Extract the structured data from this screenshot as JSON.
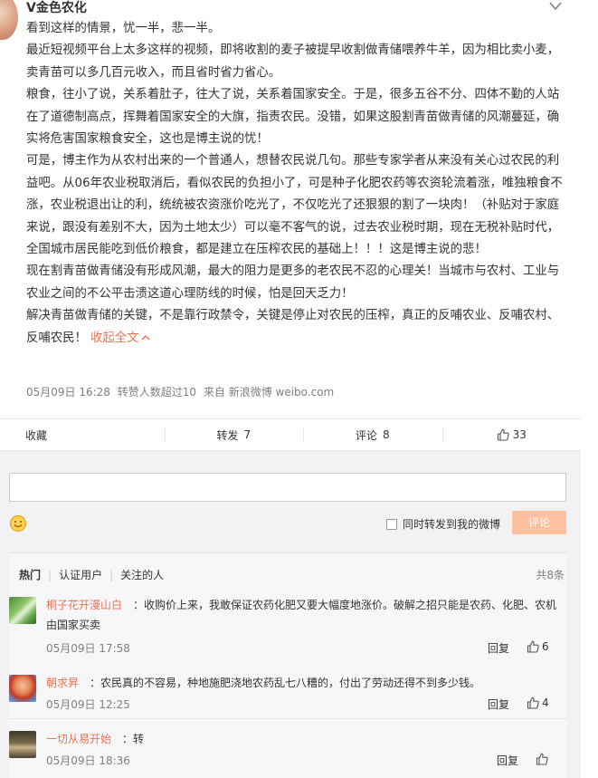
{
  "post": {
    "username": "V金色农化",
    "paragraphs": [
      "看到这样的情景，忧一半，悲一半。",
      "最近短视频平台上太多这样的视频，即将收割的麦子被提早收割做青储喂养牛羊，因为相比卖小麦，卖青苗可以多几百元收入，而且省时省力省心。",
      "粮食，往小了说，关系着肚子，往大了说，关系着国家安全。于是，很多五谷不分、四体不勤的人站在了道德制高点，挥舞着国家安全的大旗，指责农民。没错，如果这股割青苗做青储的风潮蔓延，确实将危害国家粮食安全，这也是博主说的忧！",
      "可是，博主作为从农村出来的一个普通人，想替农民说几句。那些专家学者从来没有关心过农民的利益吧。从06年农业税取消后，看似农民的负担小了，可是种子化肥农药等农资轮流着涨，唯独粮食不涨，农业税退出让的利，统统被农资涨价吃光了，不仅吃光了还狠狠的割了一块肉！（补贴对于家庭来说，跟没有差别不大，因为土地太少）可以毫不客气的说，过去农业税时期，现在无税补贴时代，全国城市居民能吃到低价粮食，都是建立在压榨农民的基础上！！！这是博主说的悲！",
      "现在割青苗做青储没有形成风潮，最大的阻力是更多的老农民不忍的心理关！当城市与农村、工业与农业之间的不公平击溃这道心理防线的时候，怕是回天乏力！"
    ],
    "last_paragraph": "解决青苗做青储的关键，不是靠行政禁令，关键是停止对农民的压榨，真正的反哺农业、反哺农村、反哺农民！",
    "collapse_label": "收起全文",
    "meta": {
      "date": "05月09日 16:28",
      "reposts_note": "转赞人数超过10",
      "source": "来自 新浪微博 weibo.com"
    }
  },
  "actions": {
    "favorite_label": "收藏",
    "repost_label": "转发",
    "repost_count": "7",
    "comment_label": "评论",
    "comment_count": "8",
    "like_count": "33"
  },
  "composer": {
    "forward_label": "同时转发到我的微博",
    "submit_label": "评论"
  },
  "comments_section": {
    "tabs": [
      "热门",
      "认证用户",
      "关注的人"
    ],
    "total": "共8条",
    "reply_label": "回复",
    "items": [
      {
        "user": "桐子花开漫山白",
        "text": "：收购价上来，我敢保证农药化肥又要大幅度地涨价。破解之招只能是农药、化肥、农机由国家买卖",
        "time": "05月09日 17:58",
        "likes": "6"
      },
      {
        "user": "朝求昇",
        "text": "：农民真的不容易，种地施肥浇地农药乱七八糟的，付出了劳动还得不到多少钱。",
        "time": "05月09日 12:25",
        "likes": "4"
      },
      {
        "user": "一切从易开始",
        "text": "：转",
        "time": "05月09日 18:36",
        "likes": ""
      }
    ]
  },
  "colors": {
    "link": "#eb7350",
    "submit_bg": "#ffc09f",
    "comment_bg": "#f2f2f5"
  }
}
